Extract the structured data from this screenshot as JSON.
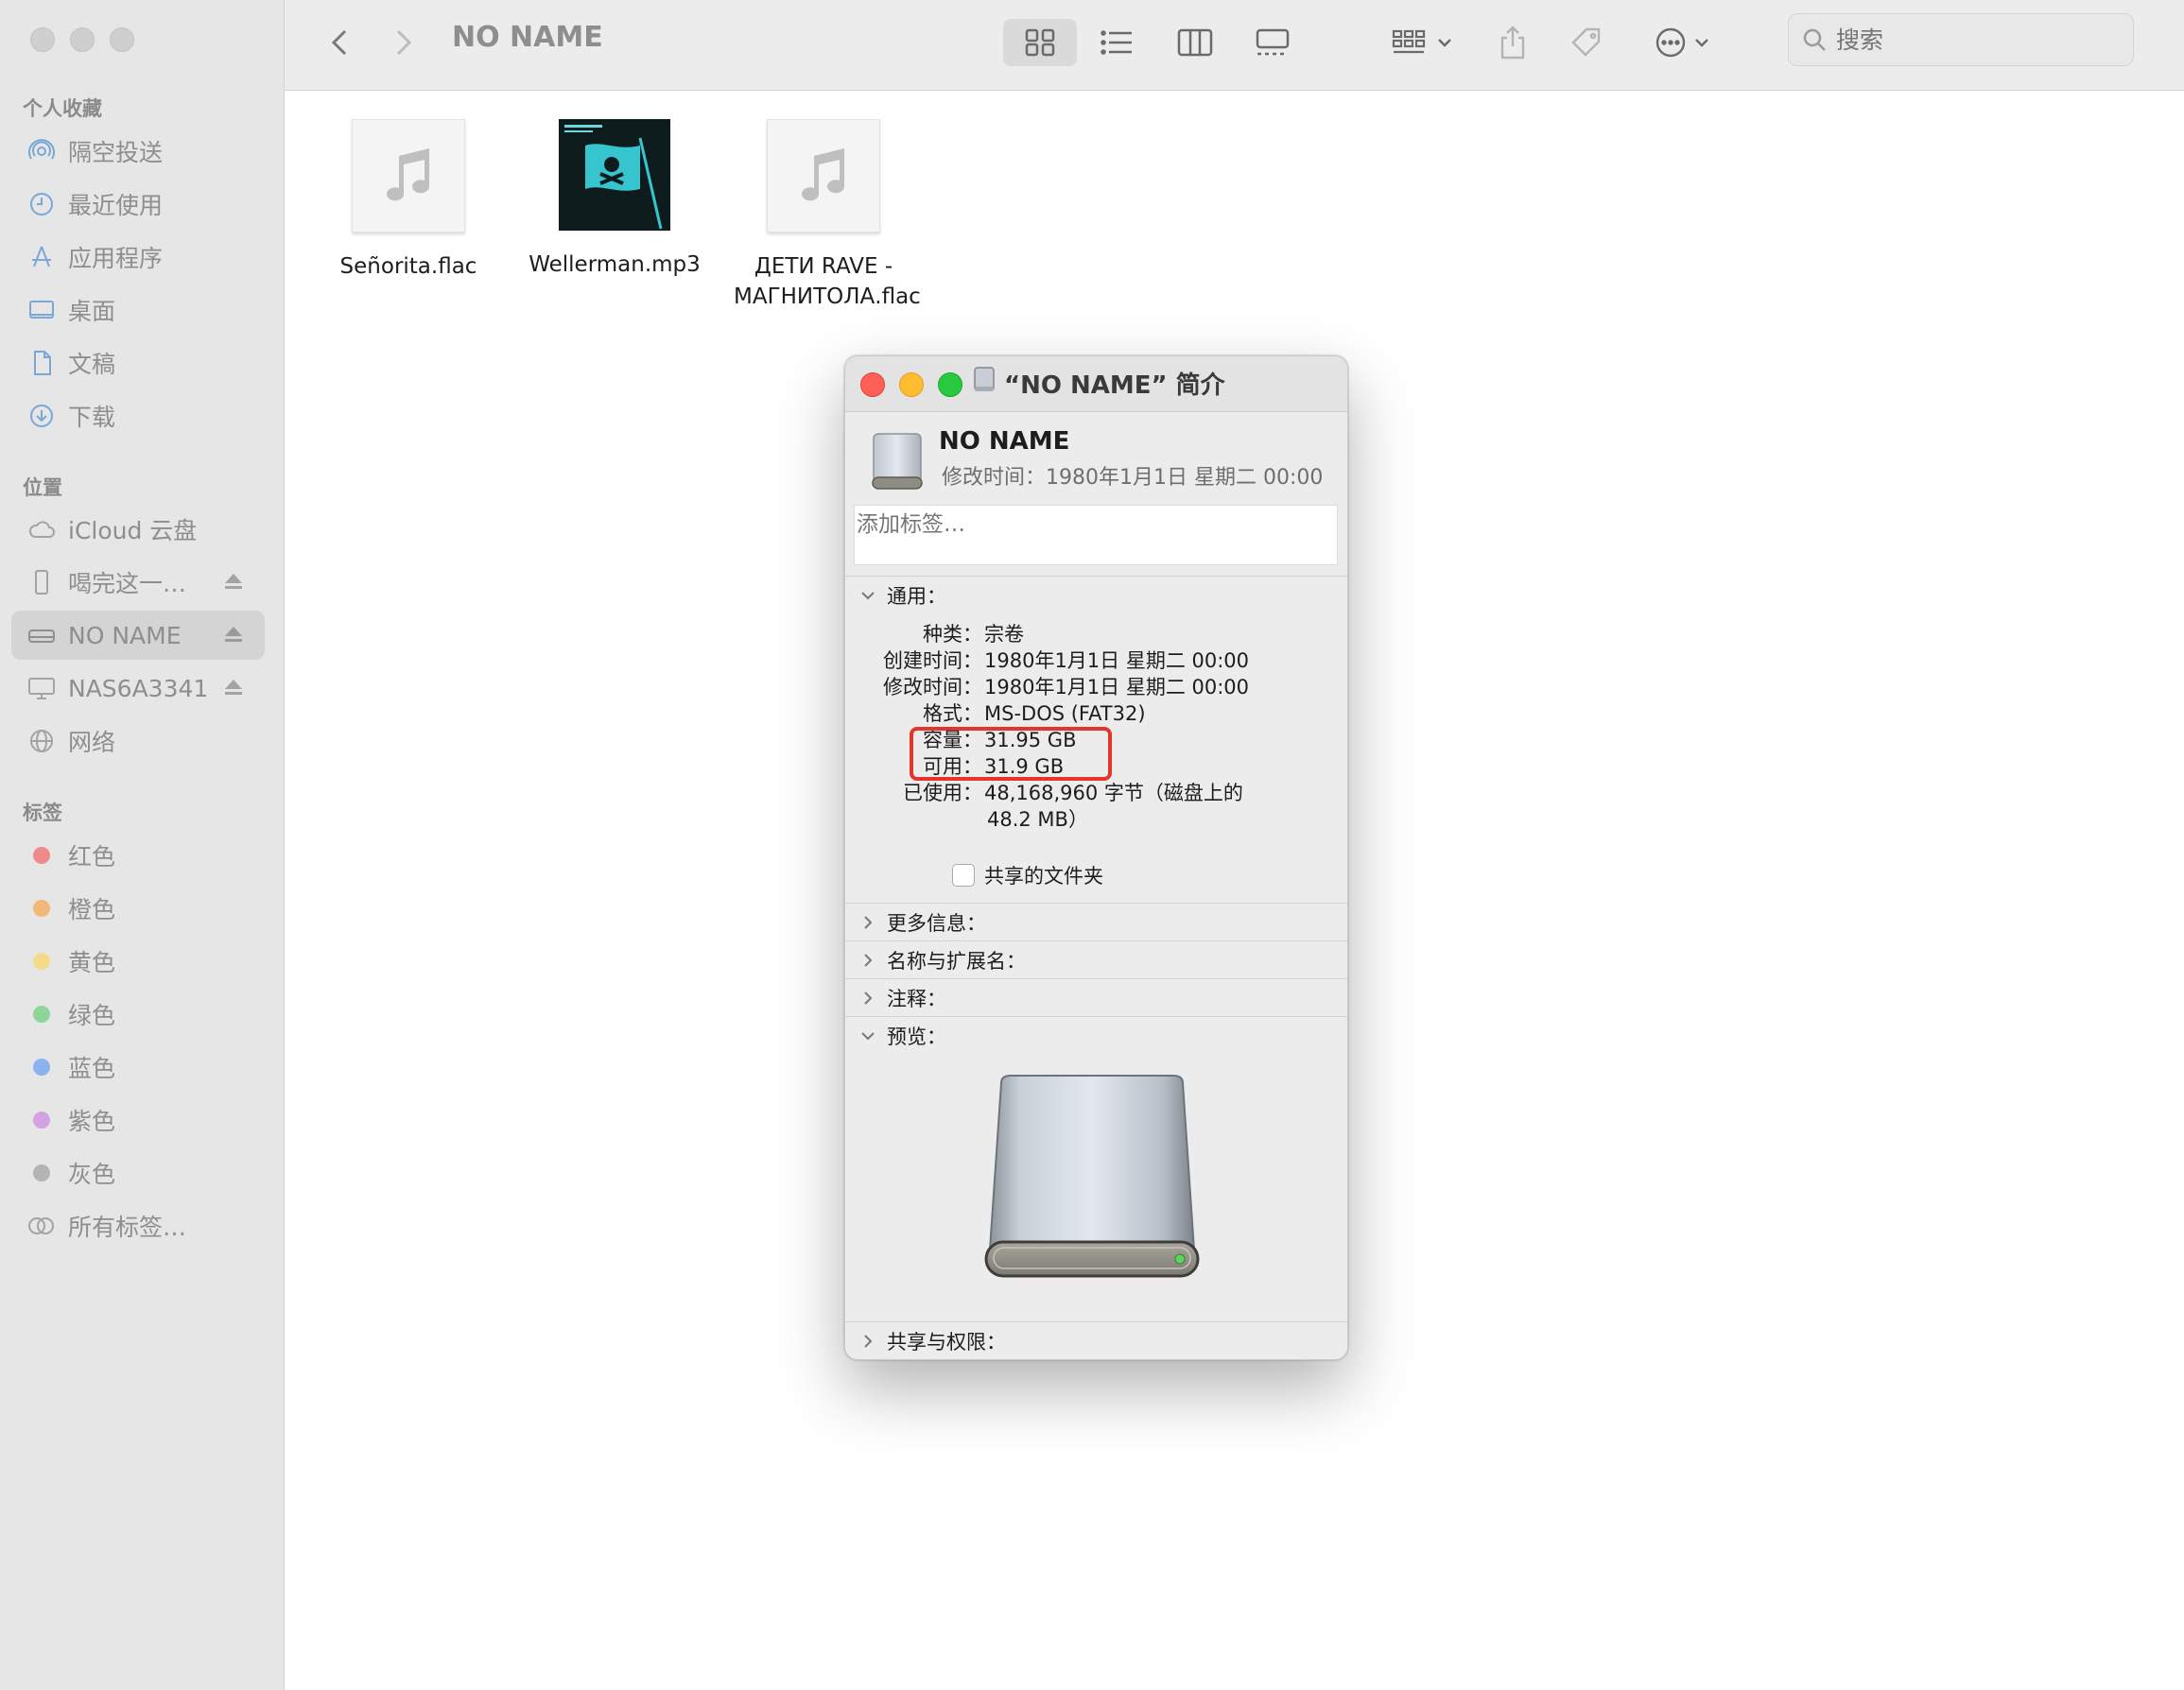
{
  "finder": {
    "title": "NO NAME",
    "search_placeholder": "搜索"
  },
  "sidebar": {
    "favorites_header": "个人收藏",
    "favorites": [
      {
        "label": "隔空投送",
        "icon": "airdrop-icon"
      },
      {
        "label": "最近使用",
        "icon": "clock-icon"
      },
      {
        "label": "应用程序",
        "icon": "applications-icon"
      },
      {
        "label": "桌面",
        "icon": "desktop-icon"
      },
      {
        "label": "文稿",
        "icon": "document-icon"
      },
      {
        "label": "下载",
        "icon": "download-icon"
      }
    ],
    "locations_header": "位置",
    "locations": [
      {
        "label": "iCloud 云盘",
        "icon": "cloud-icon"
      },
      {
        "label": "喝完这一…",
        "icon": "phone-icon"
      },
      {
        "label": "NO NAME",
        "icon": "drive-icon"
      },
      {
        "label": "NAS6A3341",
        "icon": "monitor-icon"
      },
      {
        "label": "网络",
        "icon": "globe-icon"
      }
    ],
    "tags_header": "标签",
    "tags": [
      {
        "label": "红色",
        "color": "#f08a8a"
      },
      {
        "label": "橙色",
        "color": "#f2b87a"
      },
      {
        "label": "黄色",
        "color": "#f2dc8a"
      },
      {
        "label": "绿色",
        "color": "#8fd59a"
      },
      {
        "label": "蓝色",
        "color": "#8ab4f0"
      },
      {
        "label": "紫色",
        "color": "#d2a2e2"
      },
      {
        "label": "灰色",
        "color": "#b4b4b4"
      },
      {
        "label": "所有标签…",
        "color": ""
      }
    ]
  },
  "files": [
    {
      "name": "Señorita.flac",
      "type": "audio"
    },
    {
      "name": "Wellerman.mp3",
      "type": "album-art"
    },
    {
      "name": "ДЕТИ RAVE - МАГНИТОЛА.flac",
      "type": "audio"
    }
  ],
  "info_window": {
    "title": "“NO NAME” 简介",
    "name": "NO NAME",
    "modified_summary": "修改时间：1980年1月1日 星期二 00:00",
    "tags_placeholder": "添加标签…",
    "general_header": "通用：",
    "general": {
      "kind_label": "种类：",
      "kind_value": "宗卷",
      "created_label": "创建时间：",
      "created_value": "1980年1月1日 星期二 00:00",
      "modified_label": "修改时间：",
      "modified_value": "1980年1月1日 星期二 00:00",
      "format_label": "格式：",
      "format_value": "MS-DOS (FAT32)",
      "capacity_label": "容量：",
      "capacity_value": "31.95 GB",
      "available_label": "可用：",
      "available_value": "31.9 GB",
      "used_label": "已使用：",
      "used_value_1": "48,168,960 字节（磁盘上的",
      "used_value_2": "48.2 MB）"
    },
    "shared_folder_label": "共享的文件夹",
    "more_info_header": "更多信息：",
    "name_ext_header": "名称与扩展名：",
    "comments_header": "注释：",
    "preview_header": "预览：",
    "sharing_header": "共享与权限："
  },
  "colors": {
    "close": "#fe5f57",
    "minimize": "#febc2e",
    "zoom": "#28c840",
    "highlight": "#e3352b"
  }
}
